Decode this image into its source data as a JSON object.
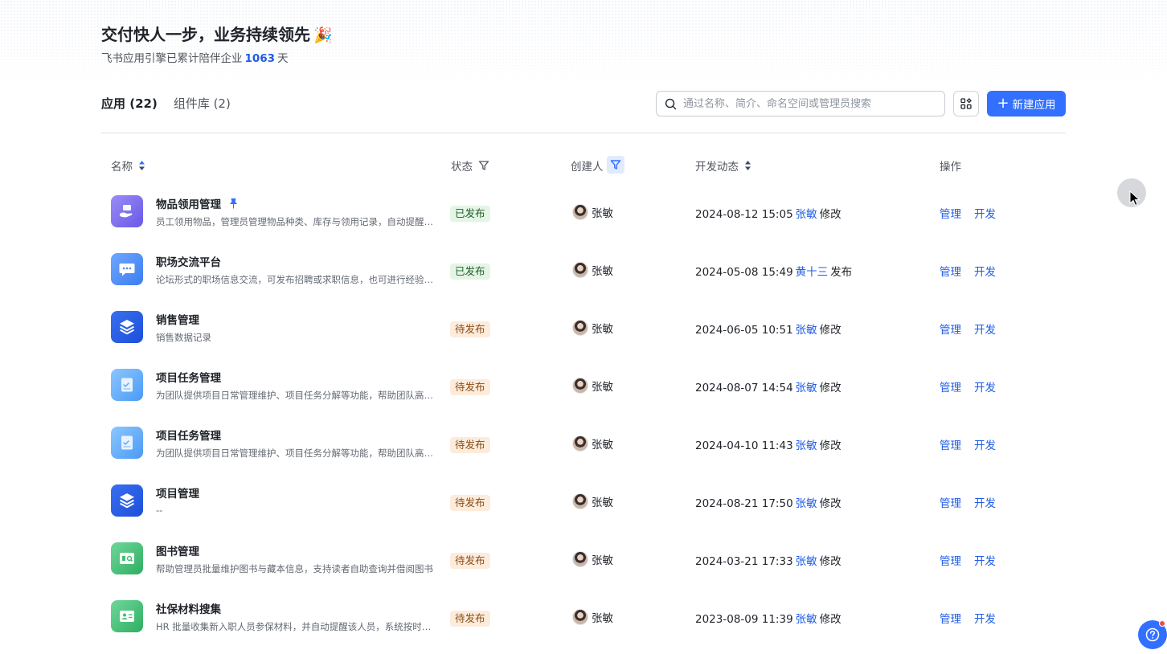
{
  "header": {
    "title": "交付快人一步，业务持续领先",
    "title_emoji": "🎉",
    "subtitle_prefix": "飞书应用引擎已累计陪伴企业",
    "subtitle_days": "1063",
    "subtitle_suffix": "天"
  },
  "tabs": [
    {
      "label": "应用 (22)",
      "active": true
    },
    {
      "label": "组件库 (2)",
      "active": false
    }
  ],
  "toolbar": {
    "search_placeholder": "通过名称、简介、命名空间或管理员搜索",
    "new_app_label": "新建应用",
    "new_app_icon": "+"
  },
  "columns": {
    "name": "名称",
    "status": "状态",
    "creator": "创建人",
    "activity": "开发动态",
    "ops": "操作"
  },
  "rows": [
    {
      "name": "物品领用管理",
      "pinned": true,
      "desc": "员工领用物品，管理员管理物品种类、库存与领用记录，自动提醒库存不足",
      "status": "已发布",
      "status_type": "pub",
      "creator": "张敏",
      "time": "2024-08-12 15:05",
      "actor": "张敏",
      "action": "修改",
      "icon": "hand-box-icon",
      "icon_color": "#7f6cf0"
    },
    {
      "name": "职场交流平台",
      "pinned": false,
      "desc": "论坛形式的职场信息交流，可发布招聘或求职信息，也可进行经验分享",
      "status": "已发布",
      "status_type": "pub",
      "creator": "张敏",
      "time": "2024-05-08 15:49",
      "actor": "黄十三",
      "action": "发布",
      "icon": "chat-bubble-icon",
      "icon_color": "#4a8bf5"
    },
    {
      "name": "销售管理",
      "pinned": false,
      "desc": "销售数据记录",
      "status": "待发布",
      "status_type": "pending",
      "creator": "张敏",
      "time": "2024-06-05 10:51",
      "actor": "张敏",
      "action": "修改",
      "icon": "layers-icon",
      "icon_color": "#245bdb"
    },
    {
      "name": "项目任务管理",
      "pinned": false,
      "desc": "为团队提供项目日常管理维护、项目任务分解等功能，帮助团队高效协作",
      "status": "待发布",
      "status_type": "pending",
      "creator": "张敏",
      "time": "2024-08-07 14:54",
      "actor": "张敏",
      "action": "修改",
      "icon": "task-doc-icon",
      "icon_color": "#5aa9f8"
    },
    {
      "name": "项目任务管理",
      "pinned": false,
      "desc": "为团队提供项目日常管理维护、项目任务分解等功能，帮助团队高效协作",
      "status": "待发布",
      "status_type": "pending",
      "creator": "张敏",
      "time": "2024-04-10 11:43",
      "actor": "张敏",
      "action": "修改",
      "icon": "task-doc-icon",
      "icon_color": "#5aa9f8"
    },
    {
      "name": "项目管理",
      "pinned": false,
      "desc": "--",
      "status": "待发布",
      "status_type": "pending",
      "creator": "张敏",
      "time": "2024-08-21 17:50",
      "actor": "张敏",
      "action": "修改",
      "icon": "layers-icon",
      "icon_color": "#245bdb"
    },
    {
      "name": "图书管理",
      "pinned": false,
      "desc": "帮助管理员批量维护图书与藏本信息，支持读者自助查询并借阅图书",
      "status": "待发布",
      "status_type": "pending",
      "creator": "张敏",
      "time": "2024-03-21 17:33",
      "actor": "张敏",
      "action": "修改",
      "icon": "book-card-icon",
      "icon_color": "#3fbf73"
    },
    {
      "name": "社保材料搜集",
      "pinned": false,
      "desc": "HR 批量收集新入职人员参保材料，并自动提醒该人员，系统按时汇总",
      "status": "待发布",
      "status_type": "pending",
      "creator": "张敏",
      "time": "2023-08-09 11:39",
      "actor": "张敏",
      "action": "修改",
      "icon": "id-card-icon",
      "icon_color": "#3fbf73"
    }
  ],
  "row_actions": {
    "manage": "管理",
    "develop": "开发"
  }
}
